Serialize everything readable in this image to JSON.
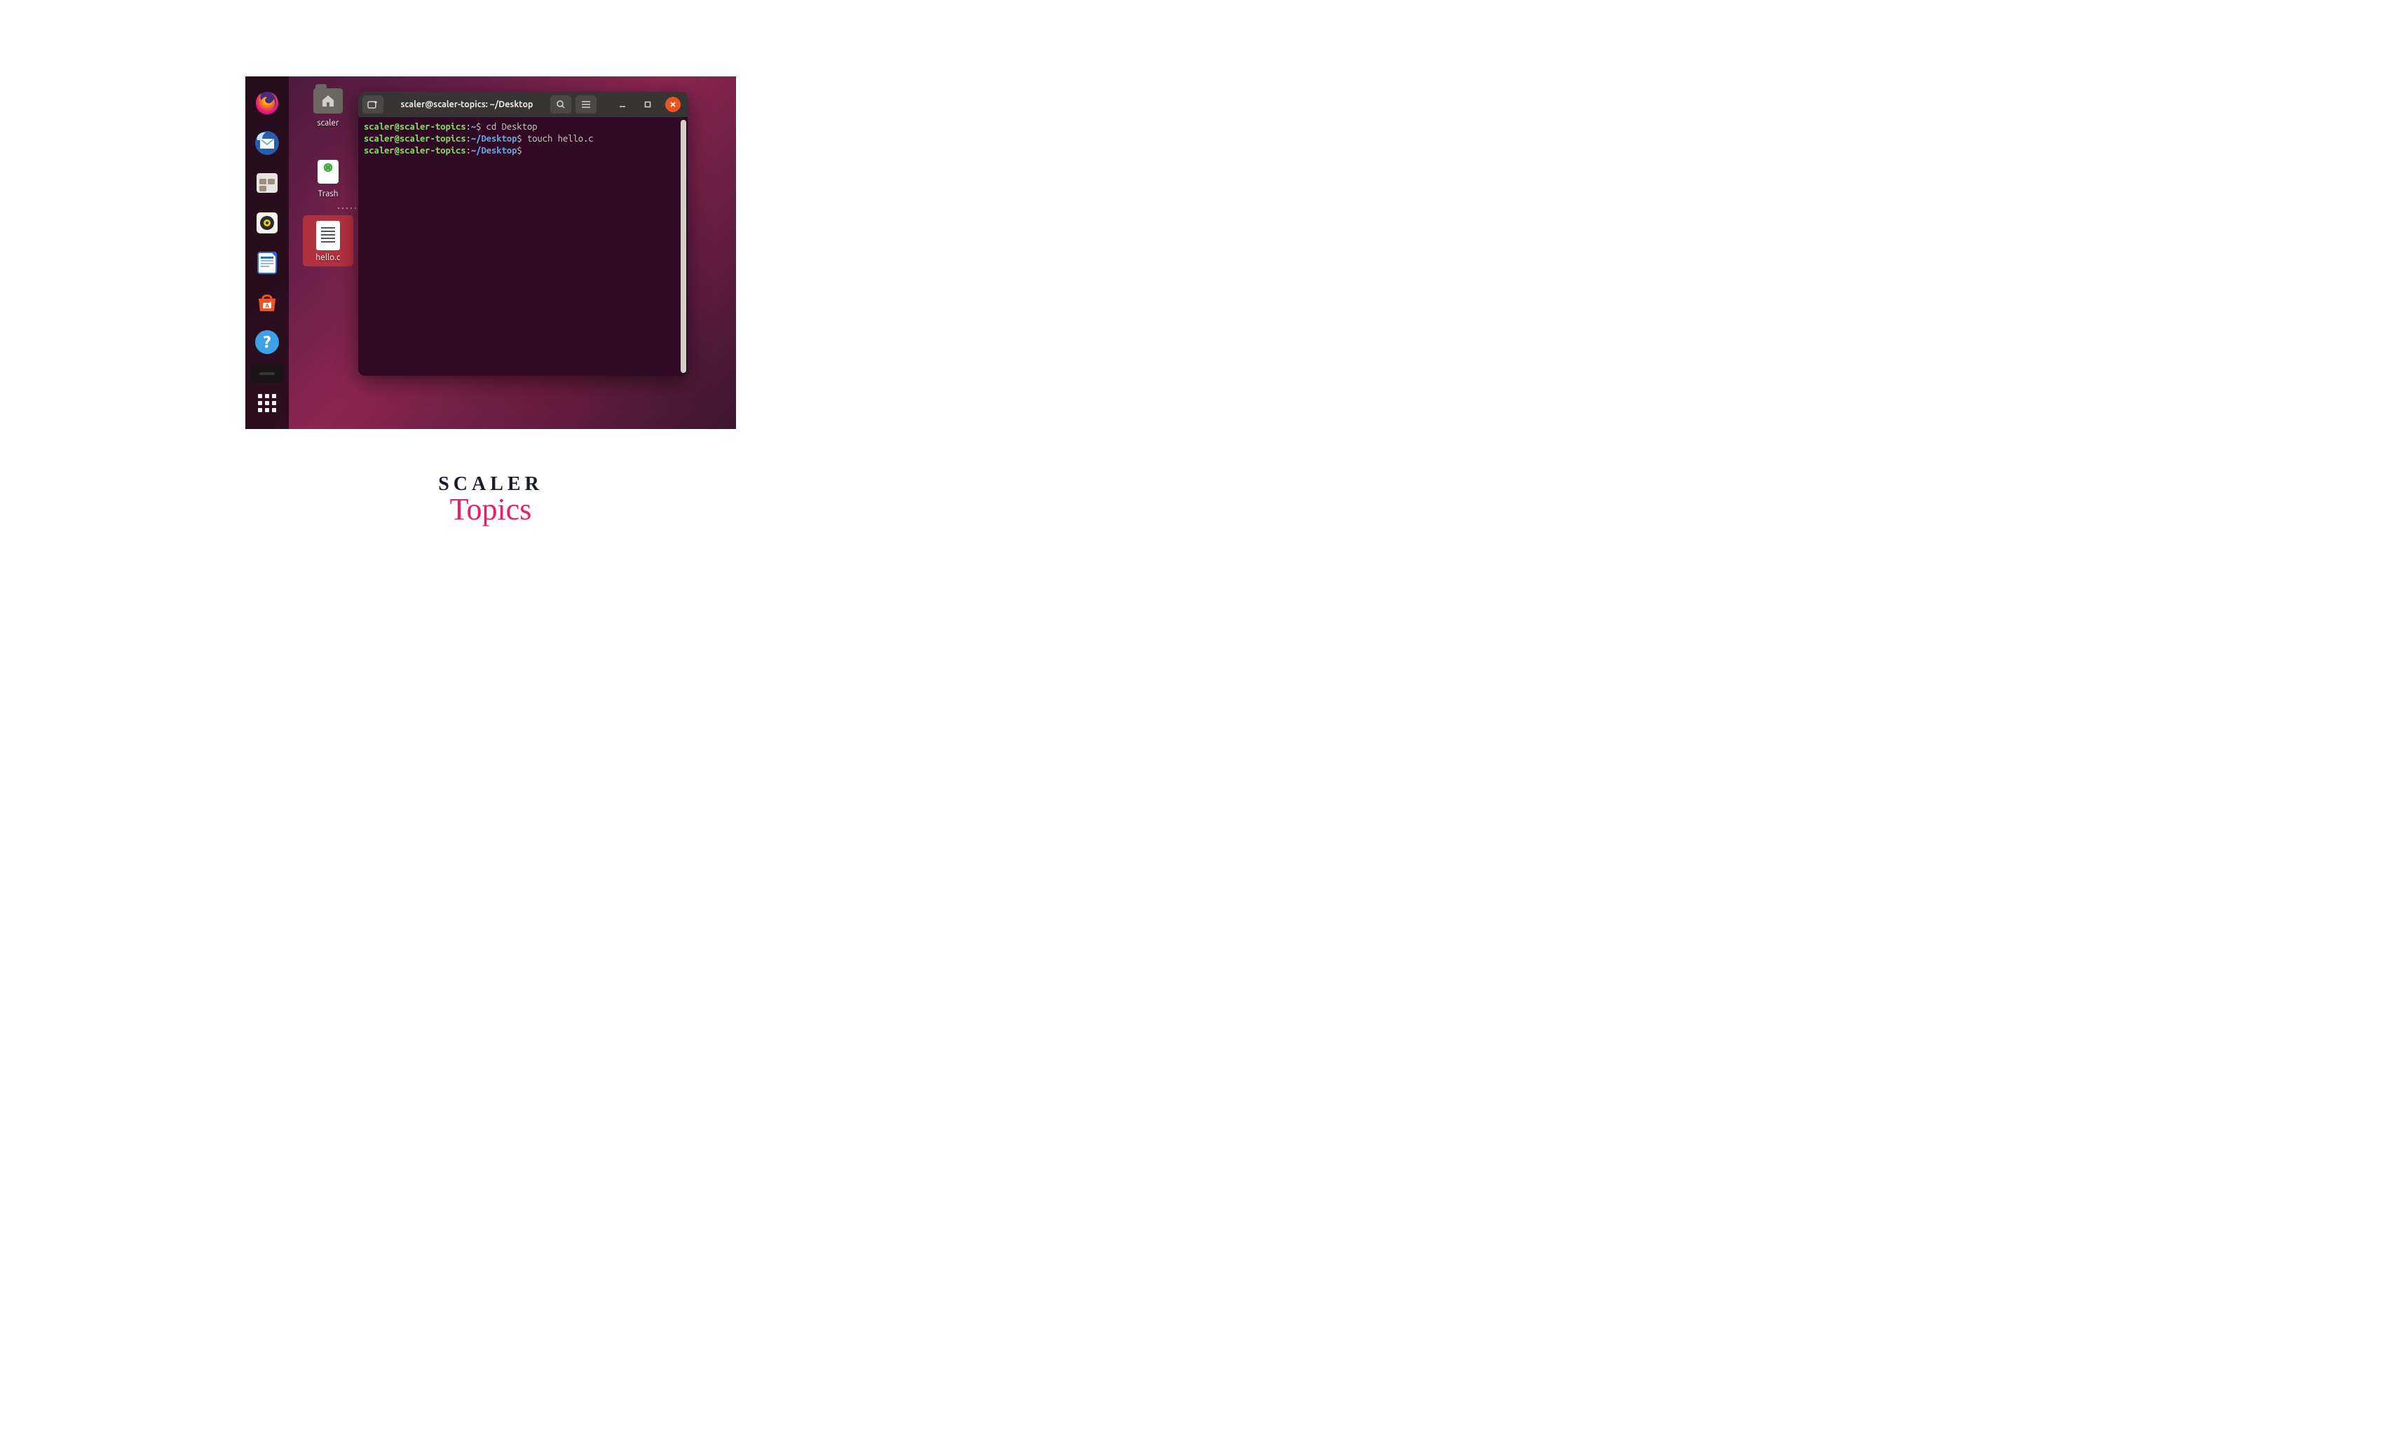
{
  "dock": {
    "items": [
      {
        "name": "firefox"
      },
      {
        "name": "thunderbird"
      },
      {
        "name": "files"
      },
      {
        "name": "rhythmbox"
      },
      {
        "name": "libreoffice-writer"
      },
      {
        "name": "ubuntu-software"
      },
      {
        "name": "help"
      },
      {
        "name": "terminal-running"
      }
    ]
  },
  "desktop": {
    "icons": [
      {
        "id": "home",
        "label": "scaler"
      },
      {
        "id": "trash",
        "label": "Trash"
      },
      {
        "id": "hello-c",
        "label": "hello.c",
        "selected": true
      }
    ]
  },
  "terminal": {
    "title": "scaler@scaler-topics: ~/Desktop",
    "buttons": {
      "new_tab": "new-tab",
      "search": "search",
      "menu": "menu",
      "min": "_",
      "max": "▢",
      "close": "×"
    },
    "lines": [
      {
        "user": "scaler@scaler-topics",
        "path": "~",
        "cmd": "cd Desktop"
      },
      {
        "user": "scaler@scaler-topics",
        "path": "~/Desktop",
        "cmd": "touch hello.c"
      },
      {
        "user": "scaler@scaler-topics",
        "path": "~/Desktop",
        "cmd": ""
      }
    ]
  },
  "logo": {
    "line1": "SCALER",
    "line2": "Topics"
  }
}
